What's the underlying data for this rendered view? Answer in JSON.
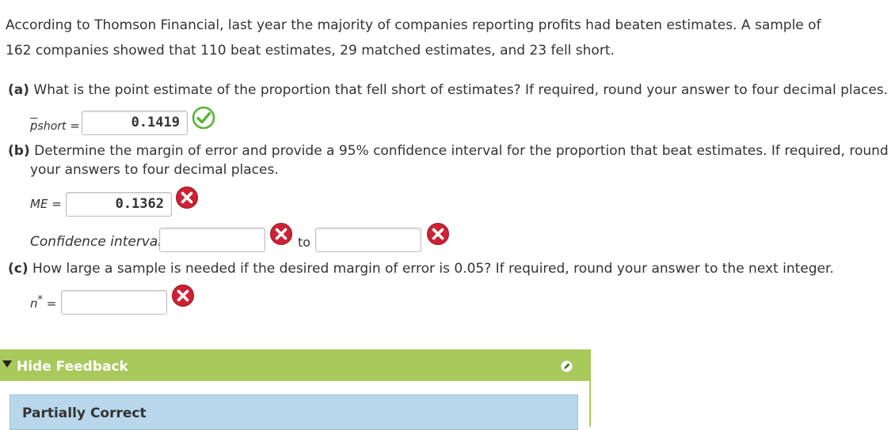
{
  "intro": {
    "line1": "According to Thomson Financial, last year the majority of companies reporting profits had beaten estimates. A sample of",
    "line2": "162 companies showed that 110 beat estimates, 29 matched estimates, and 23 fell short."
  },
  "part_a": {
    "tag": "(a)",
    "text": "What is the point estimate of the proportion that fell short of estimates? If required, round your answer to four decimal places.",
    "label_p": "p",
    "label_sub": "short",
    "label_eq": " =",
    "value": "0.1419",
    "status": "correct"
  },
  "part_b": {
    "tag": "(b)",
    "line1": "Determine the margin of error and provide a 95% confidence interval for the proportion that beat estimates. If required, round",
    "line2": "your answers to four decimal places.",
    "me_label": "ME =",
    "me_value": "0.1362",
    "ci_label": "Confidence interval:",
    "ci_lower": "",
    "ci_to": "to",
    "ci_upper": ""
  },
  "part_c": {
    "tag": "(c)",
    "text": "How large a sample is needed if the desired margin of error is 0.05? If required, round your answer to the next integer.",
    "label_n": "n",
    "label_star": "*",
    "label_eq": " =",
    "value": ""
  },
  "feedback": {
    "toggle_label": "Hide Feedback",
    "status_text": "Partially Correct"
  },
  "colors": {
    "correct": "#5cb13a",
    "incorrect": "#cc2233",
    "feedback_bar": "#a9c95c",
    "feedback_box": "#b9d7eb"
  }
}
